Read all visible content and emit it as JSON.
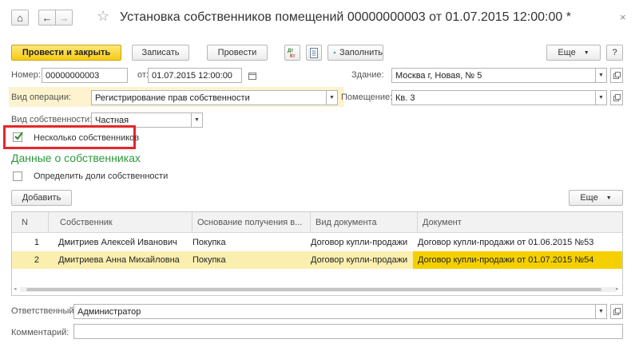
{
  "window": {
    "title": "Установка собственников помещений 00000000003 от 01.07.2015 12:00:00 *",
    "close_glyph": "×",
    "home_glyph": "⌂",
    "back_glyph": "←",
    "forward_glyph": "→",
    "star_glyph": "☆"
  },
  "toolbar": {
    "post_close_label": "Провести и закрыть",
    "save_label": "Записать",
    "post_label": "Провести",
    "fill_label": "Заполнить",
    "more_label": "Еще",
    "help_label": "?"
  },
  "form": {
    "number_label": "Номер:",
    "number_value": "00000000003",
    "date_label": "от:",
    "date_value": "01.07.2015 12:00:00",
    "building_label": "Здание:",
    "building_value": "Москва г, Новая,  № 5",
    "operation_label": "Вид операции:",
    "operation_value": "Регистрирование прав собственности",
    "premises_label": "Помещение:",
    "premises_value": "Кв. 3",
    "ownership_label": "Вид собственности:",
    "ownership_value": "Частная",
    "multiple_owners_label": "Несколько собственников",
    "multiple_owners_checked": true,
    "owners_section_title": "Данные о собственниках",
    "define_shares_label": "Определить доли собственности",
    "define_shares_checked": false,
    "add_label": "Добавить",
    "table_more_label": "Еще",
    "responsible_label": "Ответственный:",
    "responsible_value": "Администратор",
    "comment_label": "Комментарий:",
    "comment_value": ""
  },
  "table": {
    "columns": [
      "N",
      "Собственник",
      "Основание получения в...",
      "Вид документа",
      "Документ"
    ],
    "rows": [
      {
        "n": "1",
        "owner": "Дмитриев Алексей Иванович",
        "basis": "Покупка",
        "doc_type": "Договор купли-продажи",
        "document": "Договор купли-продажи от 01.06.2015 №53"
      },
      {
        "n": "2",
        "owner": "Дмитриева Анна Михайловна",
        "basis": "Покупка",
        "doc_type": "Договор купли-продажи",
        "document": "Договор купли-продажи от 01.07.2015 №54"
      }
    ],
    "selected_row": 2
  },
  "colors": {
    "accent_yellow": "#f6cb12",
    "selected_row": "#fbefb0",
    "selected_cell": "#f5d000",
    "section_green": "#2a9a3b",
    "highlight_red": "#e5262a"
  }
}
